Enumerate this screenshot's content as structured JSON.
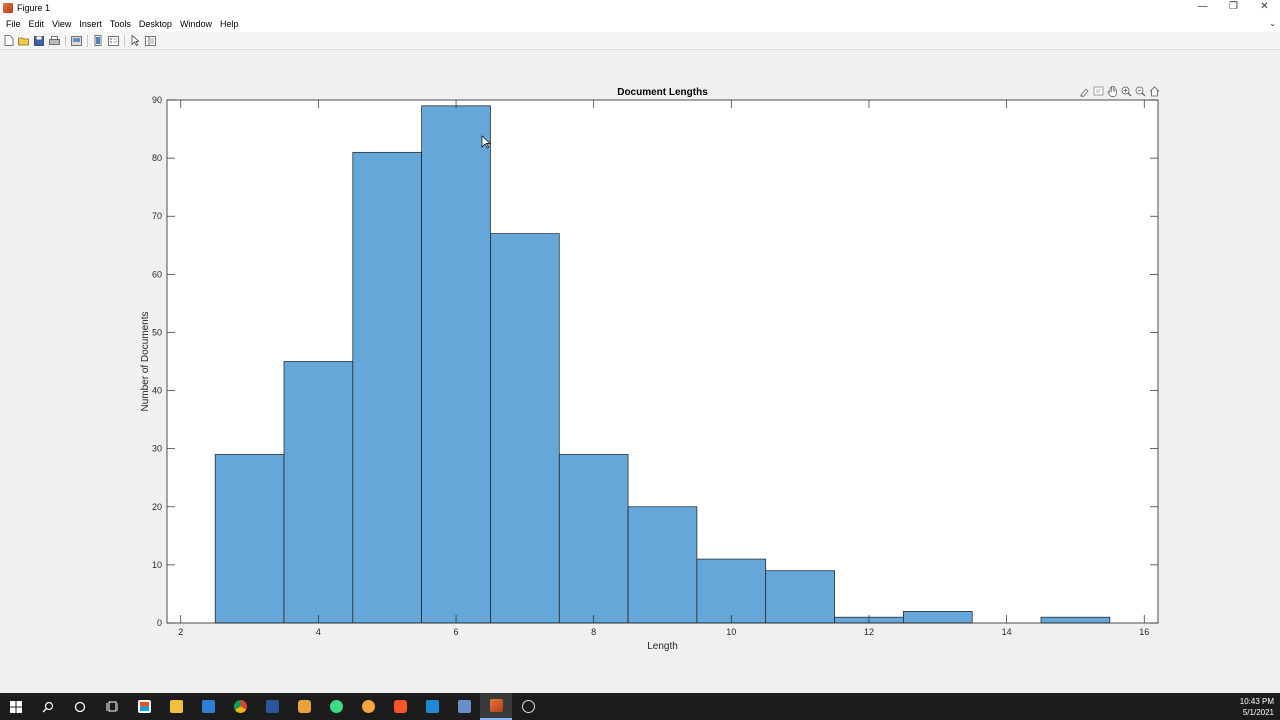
{
  "window": {
    "title": "Figure 1",
    "controls": [
      "—",
      "❐",
      "✕"
    ]
  },
  "menubar": {
    "items": [
      "File",
      "Edit",
      "View",
      "Insert",
      "Tools",
      "Desktop",
      "Window",
      "Help"
    ]
  },
  "toolbar": {
    "icons": [
      "new-figure-icon",
      "open-file-icon",
      "save-icon",
      "print-icon",
      "print-preview-icon",
      "colorbar-icon",
      "legend-icon",
      "pointer-icon",
      "property-editor-icon"
    ]
  },
  "axes_toolbar": {
    "icons": [
      "brush-icon",
      "data-tips-icon",
      "pan-icon",
      "zoom-in-icon",
      "zoom-out-icon",
      "home-icon"
    ]
  },
  "colors": {
    "bar_fill": "#64a7d8",
    "bar_edge": "#1a1a1a",
    "axes_bg": "#ffffff"
  },
  "chart_data": {
    "type": "bar",
    "title": "Document Lengths",
    "xlabel": "Length",
    "ylabel": "Number of Documents",
    "xlim": [
      1.8,
      16.2
    ],
    "ylim": [
      0,
      90
    ],
    "xticks": [
      2,
      4,
      6,
      8,
      10,
      12,
      14,
      16
    ],
    "yticks": [
      0,
      10,
      20,
      30,
      40,
      50,
      60,
      70,
      80,
      90
    ],
    "grid": false,
    "bins": [
      {
        "start": 2.5,
        "end": 3.5,
        "value": 29
      },
      {
        "start": 3.5,
        "end": 4.5,
        "value": 45
      },
      {
        "start": 4.5,
        "end": 5.5,
        "value": 81
      },
      {
        "start": 5.5,
        "end": 6.5,
        "value": 89
      },
      {
        "start": 6.5,
        "end": 7.5,
        "value": 67
      },
      {
        "start": 7.5,
        "end": 8.5,
        "value": 29
      },
      {
        "start": 8.5,
        "end": 9.5,
        "value": 20
      },
      {
        "start": 9.5,
        "end": 10.5,
        "value": 11
      },
      {
        "start": 10.5,
        "end": 11.5,
        "value": 9
      },
      {
        "start": 11.5,
        "end": 12.5,
        "value": 1
      },
      {
        "start": 12.5,
        "end": 13.5,
        "value": 2
      },
      {
        "start": 13.5,
        "end": 14.5,
        "value": 0
      },
      {
        "start": 14.5,
        "end": 15.5,
        "value": 1
      }
    ]
  },
  "taskbar": {
    "icons": [
      "start-icon",
      "search-icon",
      "cortana-icon",
      "task-view-icon",
      "store-icon",
      "file-explorer-icon",
      "mail-icon",
      "chrome-icon",
      "word-icon",
      "app-icon",
      "android-studio-icon",
      "app-icon-2",
      "brave-icon",
      "vscode-icon",
      "app-icon-3",
      "matlab-icon",
      "app-icon-4"
    ],
    "time": "10:43 PM",
    "date": "5/1/2021"
  }
}
